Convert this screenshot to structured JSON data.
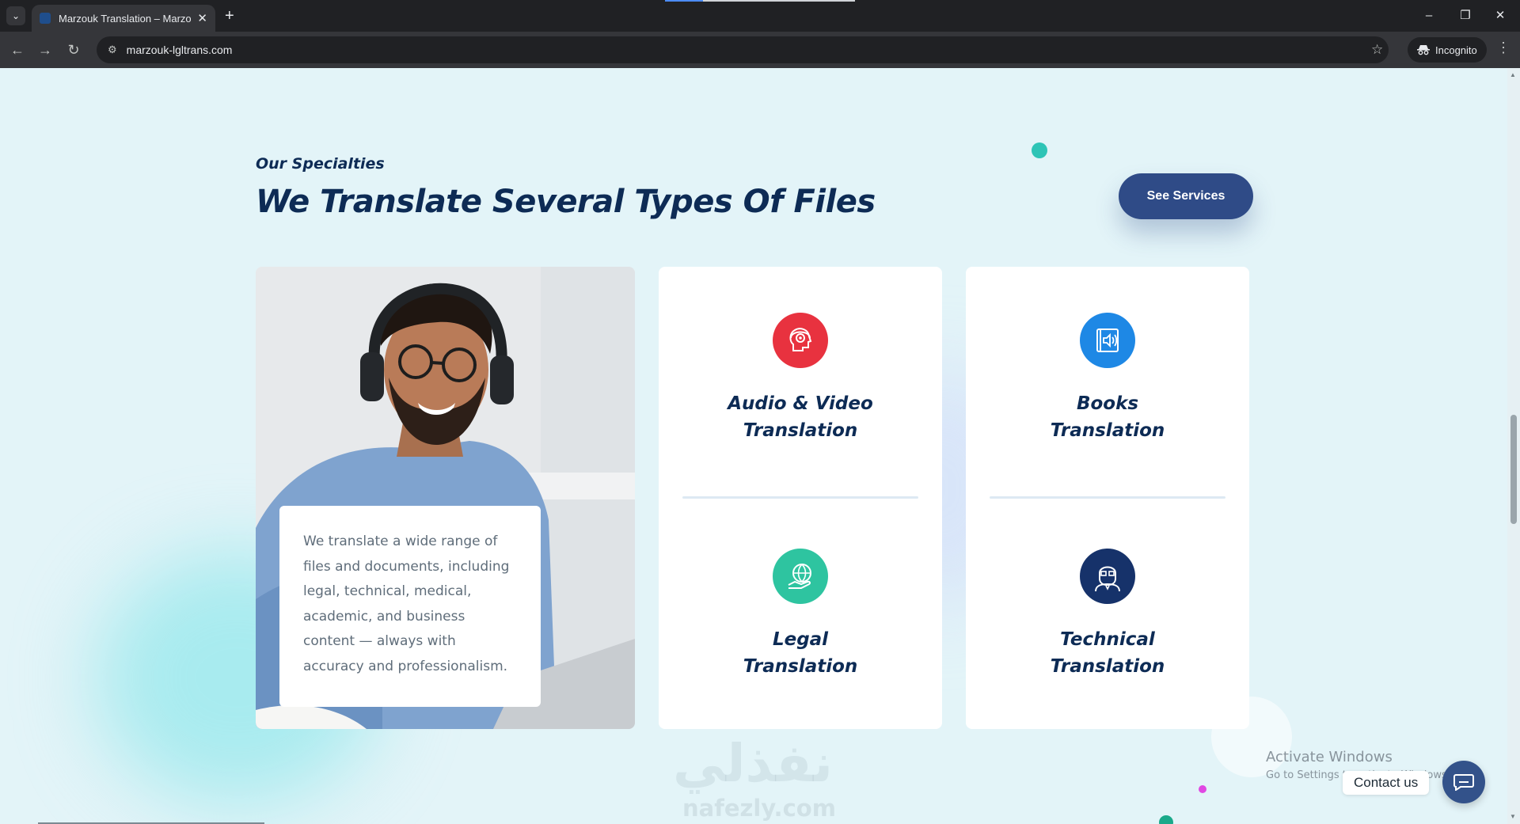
{
  "browser": {
    "tab_title": "Marzouk Translation – Marzouk",
    "url": "marzouk-lgltrans.com",
    "incognito_label": "Incognito"
  },
  "section": {
    "eyebrow": "Our Specialties",
    "headline": "We Translate Several Types Of Files",
    "cta_label": "See Services"
  },
  "description": "We translate a wide range of files and documents, including legal, technical, medical, academic, and business content — always with accuracy and professionalism.",
  "services": [
    {
      "title_line1": "Audio & Video",
      "title_line2": "Translation",
      "icon": "headphones-head-icon",
      "color": "#e8323f"
    },
    {
      "title_line1": "Books",
      "title_line2": "Translation",
      "icon": "audiobook-icon",
      "color": "#1e88e5"
    },
    {
      "title_line1": "Legal",
      "title_line2": "Translation",
      "icon": "globe-hand-icon",
      "color": "#2ec4a0"
    },
    {
      "title_line1": "Technical",
      "title_line2": "Translation",
      "icon": "technician-icon",
      "color": "#16326a"
    }
  ],
  "watermark": {
    "arabic": "نفذلي",
    "latin": "nafezly.com"
  },
  "os_overlay": {
    "title": "Activate Windows",
    "subtitle": "Go to Settings to activate Windows."
  },
  "chat": {
    "label": "Contact us"
  },
  "colors": {
    "heading": "#0d2b55",
    "accent_button": "#2f4b87",
    "page_bg": "#e3f4f8"
  }
}
